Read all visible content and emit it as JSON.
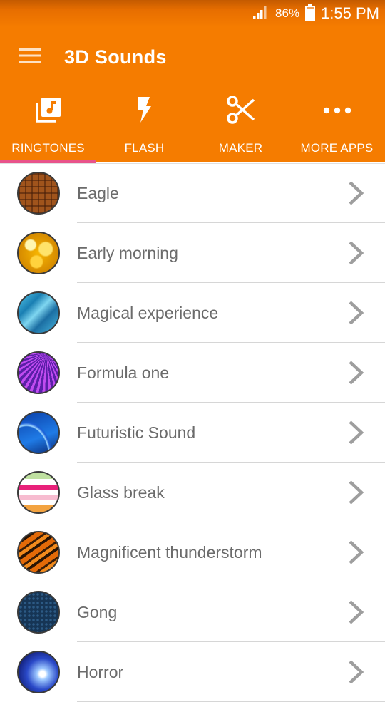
{
  "status_bar": {
    "battery_percent": "86%",
    "time": "1:55 PM",
    "icons": [
      "signal-icon",
      "battery-icon"
    ]
  },
  "app_bar": {
    "title": "3D Sounds",
    "menu_icon": "menu-icon"
  },
  "tabs": [
    {
      "label": "RINGTONES",
      "icon": "music-library-icon",
      "selected": true
    },
    {
      "label": "FLASH",
      "icon": "flash-icon",
      "selected": false
    },
    {
      "label": "MAKER",
      "icon": "scissors-icon",
      "selected": false
    },
    {
      "label": "MORE APPS",
      "icon": "more-dots-icon",
      "selected": false
    }
  ],
  "colors": {
    "primary": "#f57c00",
    "tab_indicator": "#e8538a",
    "list_text": "#6b6b6b",
    "chevron": "#9e9e9e"
  },
  "ringtones": [
    {
      "name": "Eagle",
      "thumbnail": "brown-mosaic"
    },
    {
      "name": "Early morning",
      "thumbnail": "golden-bubbles"
    },
    {
      "name": "Magical experience",
      "thumbnail": "blue-water"
    },
    {
      "name": "Formula one",
      "thumbnail": "purple-rays"
    },
    {
      "name": "Futuristic Sound",
      "thumbnail": "blue-waves"
    },
    {
      "name": "Glass break",
      "thumbnail": "pastel-stripes"
    },
    {
      "name": "Magnificent thunderstorm",
      "thumbnail": "tiger-stripes"
    },
    {
      "name": "Gong",
      "thumbnail": "dark-blue-dots"
    },
    {
      "name": "Horror",
      "thumbnail": "electric-blue"
    }
  ]
}
